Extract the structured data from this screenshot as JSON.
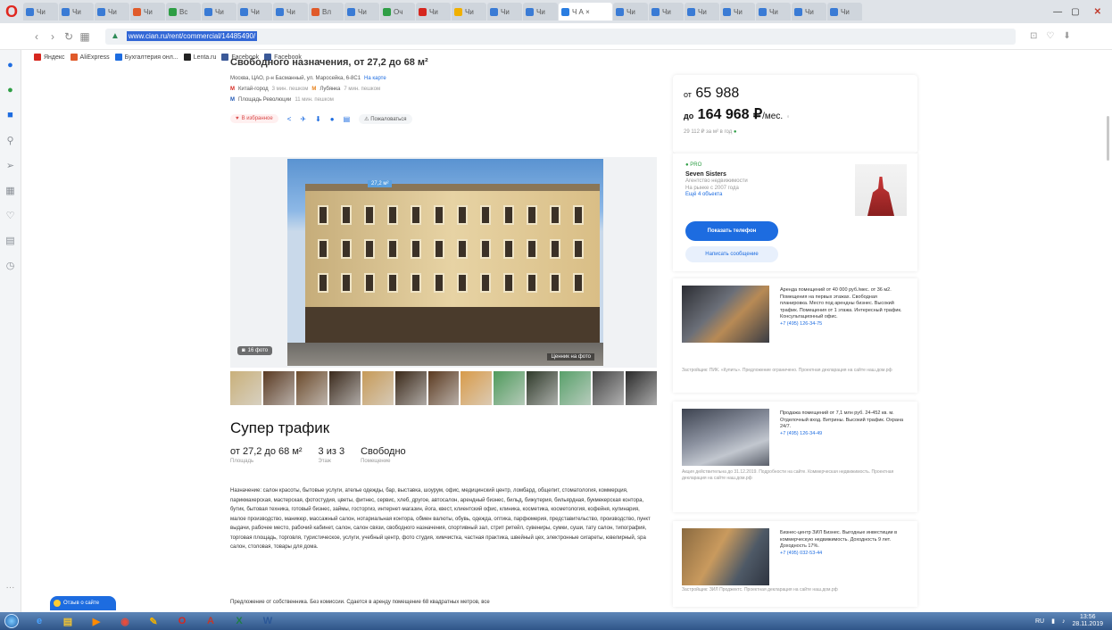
{
  "browser": {
    "tabs": [
      {
        "label": "Чи",
        "color": "#3a7bd5"
      },
      {
        "label": "Чи",
        "color": "#3a7bd5"
      },
      {
        "label": "Чи",
        "color": "#3a7bd5"
      },
      {
        "label": "Чи",
        "color": "#e05a2a"
      },
      {
        "label": "Вс",
        "color": "#2e9e45"
      },
      {
        "label": "Чи",
        "color": "#3a7bd5"
      },
      {
        "label": "Чи",
        "color": "#3a7bd5"
      },
      {
        "label": "Чи",
        "color": "#3a7bd5"
      },
      {
        "label": "Вл",
        "color": "#e05a2a"
      },
      {
        "label": "Чи",
        "color": "#3a7bd5"
      },
      {
        "label": "Оч",
        "color": "#2e9e45"
      },
      {
        "label": "Чи",
        "color": "#d6271f"
      },
      {
        "label": "Чи",
        "color": "#f0b000"
      },
      {
        "label": "Чи",
        "color": "#3a7bd5"
      },
      {
        "label": "Чи",
        "color": "#3a7bd5"
      },
      {
        "label": "Чи",
        "color": "#3a7bd5"
      },
      {
        "label": "Чи",
        "color": "#3a7bd5"
      },
      {
        "label": "Чи",
        "color": "#3a7bd5"
      },
      {
        "label": "Чи",
        "color": "#3a7bd5"
      },
      {
        "label": "Чи",
        "color": "#3a7bd5"
      },
      {
        "label": "Чи",
        "color": "#3a7bd5"
      },
      {
        "label": "Чи",
        "color": "#3a7bd5"
      }
    ],
    "active_tab": "Ч А ×",
    "url": "www.cian.ru/rent/commercial/14485490/",
    "bookmarks": [
      {
        "label": "Яндекс",
        "color": "#d6271f"
      },
      {
        "label": "AliExpress",
        "color": "#e05a2a"
      },
      {
        "label": "Бухгалтерия онл...",
        "color": "#1d6ce0"
      },
      {
        "label": "Lenta.ru",
        "color": "#222222"
      },
      {
        "label": "Facebook",
        "color": "#3b5998"
      },
      {
        "label": "Facebook",
        "color": "#3b5998"
      }
    ]
  },
  "listing": {
    "title": "Свободного назначения, от 27,2 до 68 м²",
    "address": "Москва, ЦАО, р-н Басманный, ул. Маросейка, 6-8С1",
    "address_link": "На карте",
    "metro": [
      {
        "name": "Китай-город",
        "time": "3 мин. пешком"
      },
      {
        "name": "Лубянка",
        "time": "7 мин. пешком"
      },
      {
        "name": "Площадь Революции",
        "time": "11 мин. пешком"
      }
    ],
    "favorite_label": "В избранное",
    "complain_label": "Пожаловаться",
    "photo_count": "16 фото",
    "photo_tag": "Ценник на фото",
    "photo_price_tag": "27,2 м²",
    "headline": "Супер трафик",
    "facts": [
      {
        "value": "от 27,2 до 68 м²",
        "label": "Площадь"
      },
      {
        "value": "3 из 3",
        "label": "Этаж"
      },
      {
        "value": "Свободно",
        "label": "Помещение"
      }
    ],
    "description": "Назначение: салон красоты, бытовые услуги, ателье одежды, бар, выставка, шоурум, офис, медицинский центр, ломбард, общепит, стоматология, коммерция, парикмахерская, мастерская, фотостудия, цветы, фитнес, сервис, хлеб, другое, автосалон, арендный бизнес, бильд, бижутерия, бильярдная, букмекерская контора, бутик, бытовая техника, готовый бизнес, займы, госторгиз, интернет-магазин, йога, квест, клиентский офис, клиника, косметика, косметология, кофейня, кулинария, малое производство, маникюр, массажный салон, нотариальная контора, обмен валюты, обувь, одежда, оптика, парфюмерия, представительство, производство, пункт выдачи, рабочее место, рабочий кабинет, салон, салон связи, свободного назначения, спортивный зал, стрит ритейл, сувениры, сумки, суши, тату салон, типография, торговая площадь, торговля, туристическое, услуги, учебный центр, фото студия, химчистка, частная практика, швейный цех, электронные сигареты, ювелирный, spa салон, столовая, товары для дома.",
    "description_more": "Предложение от собственника. Без комиссии. Сдается в аренду помещение 68 квадратных метров, все"
  },
  "price": {
    "from_prefix": "от",
    "from": "65 988",
    "to_prefix": "до",
    "to": "164 968 ₽",
    "unit": "/мес.",
    "sub": "29 112 ₽ за м² в год",
    "sub_icon": "●"
  },
  "agent": {
    "badge": "PRO",
    "name": "Seven Sisters",
    "meta1": "Агентство недвижимости",
    "meta2": "На рынке с 2007 года",
    "link": "Ещё 4 объекта",
    "phone_button": "Показать телефон",
    "message_button": "Написать сообщение"
  },
  "ads": [
    {
      "text": "Аренда помещений от 40 000 руб./мес. от 36 м2. Помещения на первых этажах. Свободная планировка. Место под арендны бизнес. Высокий трафик. Помещения от 1 этажа. Интересный трафик. Консультационный офис.",
      "phone": "+7 (495) 126-34-75",
      "foot": "Застройщик: ПИК. «Купить». Предложение ограничено. Проектная декларация на сайте наш.дом.рф"
    },
    {
      "text": "Продажа помещений от 7,1 млн руб. 24-452 кв. м. Отделочный вход. Витрины. Высокий трафик. Охрана 24/7.",
      "phone": "+7 (495) 126-34-49",
      "foot": "Акция действительна до 31.12.2019. Подробности на сайте. Коммерческая недвижимость. Проектная декларация на сайте наш.дом.рф"
    },
    {
      "text": "Бизнес-центр ЗИЛ Бизнес. Выгодные инвестиции в коммерческую недвижимость. Доходность 9 лет. Доходность 17%.",
      "phone": "+7 (495) 032-53-44",
      "foot": "Застройщик: ЗИЛ Проджектс. Проектная декларация на сайте наш.дом.рф"
    }
  ],
  "chat": {
    "label": "Отзыв о сайте"
  },
  "taskbar": {
    "apps": [
      {
        "name": "ie",
        "glyph": "e",
        "color": "#4aa3ff"
      },
      {
        "name": "explorer",
        "glyph": "▤",
        "color": "#f4c430"
      },
      {
        "name": "media",
        "glyph": "▶",
        "color": "#ff8a00"
      },
      {
        "name": "chrome",
        "glyph": "◉",
        "color": "#e74c3c"
      },
      {
        "name": "paint",
        "glyph": "✎",
        "color": "#f0b000"
      },
      {
        "name": "opera",
        "glyph": "O",
        "color": "#d6271f"
      },
      {
        "name": "acrobat",
        "glyph": "A",
        "color": "#c0392b"
      },
      {
        "name": "excel",
        "glyph": "X",
        "color": "#1e7e45"
      },
      {
        "name": "word",
        "glyph": "W",
        "color": "#2b5797"
      }
    ],
    "time": "13:56",
    "date": "28.11.2019"
  }
}
